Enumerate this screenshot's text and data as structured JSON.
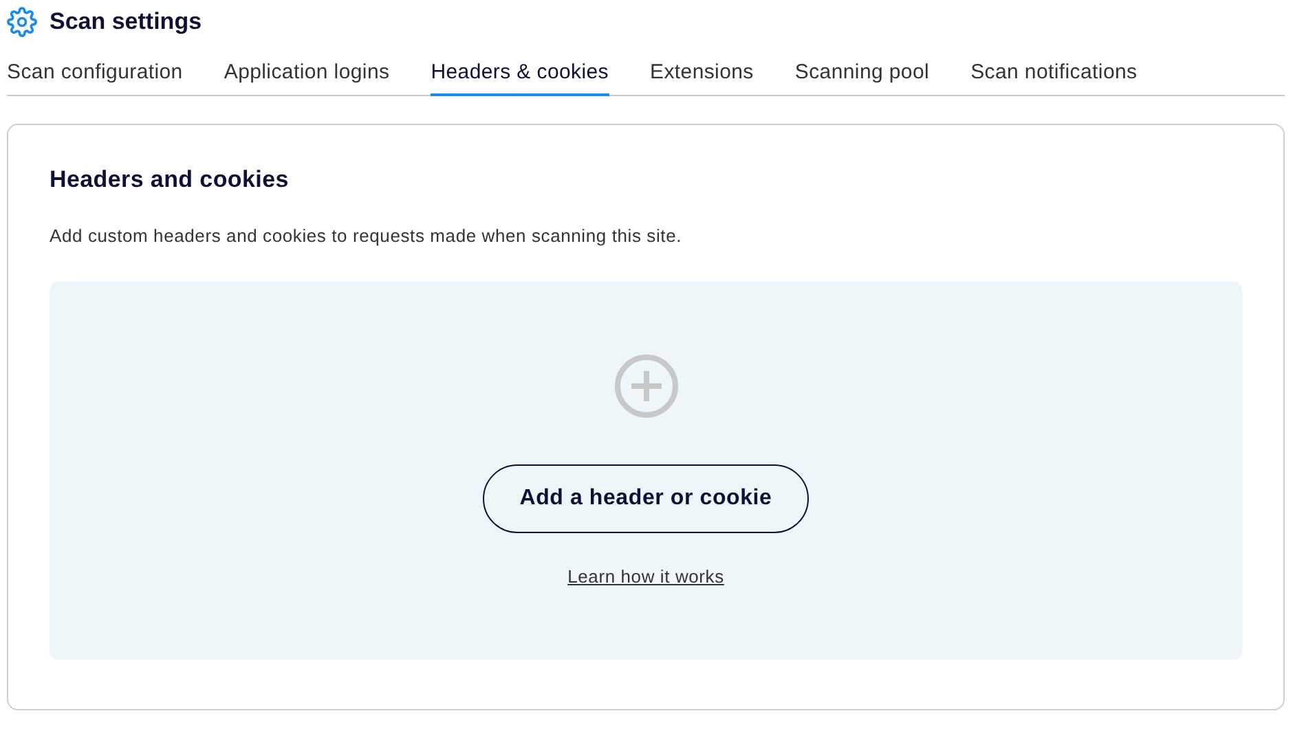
{
  "header": {
    "title": "Scan settings"
  },
  "tabs": [
    {
      "label": "Scan configuration",
      "selected": false
    },
    {
      "label": "Application logins",
      "selected": false
    },
    {
      "label": "Headers & cookies",
      "selected": true
    },
    {
      "label": "Extensions",
      "selected": false
    },
    {
      "label": "Scanning pool",
      "selected": false
    },
    {
      "label": "Scan notifications",
      "selected": false
    }
  ],
  "card": {
    "title": "Headers and cookies",
    "description": "Add custom headers and cookies to requests made when scanning this site.",
    "empty_state": {
      "button": "Add a header or cookie",
      "link": "Learn how it works"
    }
  }
}
